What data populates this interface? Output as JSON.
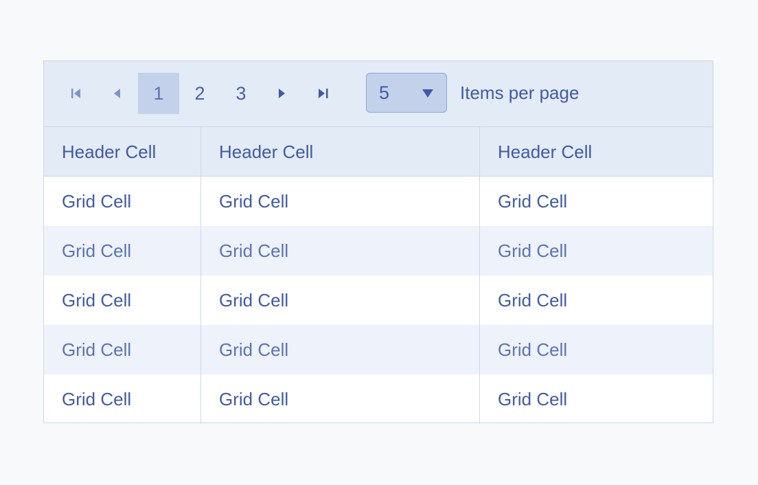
{
  "pager": {
    "pages": [
      "1",
      "2",
      "3"
    ],
    "current_page": "1",
    "per_page_value": "5",
    "per_page_label": "Items per page"
  },
  "table": {
    "headers": [
      "Header Cell",
      "Header Cell",
      "Header Cell"
    ],
    "rows": [
      [
        "Grid Cell",
        "Grid Cell",
        "Grid Cell"
      ],
      [
        "Grid Cell",
        "Grid Cell",
        "Grid Cell"
      ],
      [
        "Grid Cell",
        "Grid Cell",
        "Grid Cell"
      ],
      [
        "Grid Cell",
        "Grid Cell",
        "Grid Cell"
      ],
      [
        "Grid Cell",
        "Grid Cell",
        "Grid Cell"
      ]
    ]
  },
  "colors": {
    "accent": "#3f5aa8",
    "header_bg": "#e3ebf6",
    "alt_row_bg": "#eef2fb",
    "active_page_bg": "#c4d1eb"
  },
  "icons": [
    "first-page-icon",
    "previous-page-icon",
    "next-page-icon",
    "last-page-icon",
    "dropdown-arrow-icon"
  ]
}
